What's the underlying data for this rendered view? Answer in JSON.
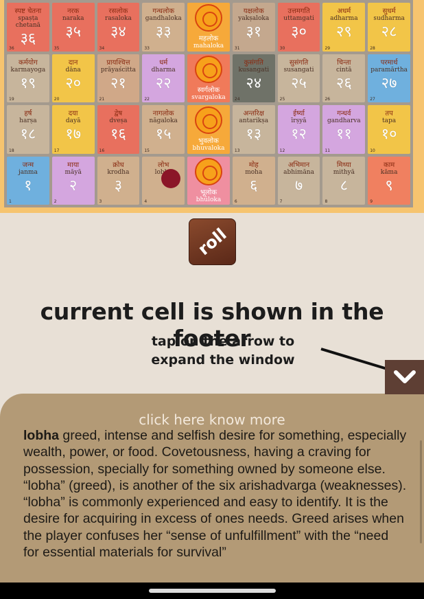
{
  "board": {
    "rows": [
      [
        {
          "dev": "स्पष्ट चेतना",
          "lat": "spaṣṭa chetanā",
          "num": "३६",
          "idx": "36",
          "color": "#e8705e"
        },
        {
          "dev": "नरक",
          "lat": "naraka",
          "num": "३५",
          "idx": "35",
          "color": "#e8705e"
        },
        {
          "dev": "रसलोक",
          "lat": "rasaloka",
          "num": "३४",
          "idx": "34",
          "color": "#e8705e"
        },
        {
          "dev": "गन्धलोक",
          "lat": "gandhaloka",
          "num": "३३",
          "idx": "33",
          "color": "#d0b08e"
        },
        {
          "dev": "महलोक",
          "lat": "mahaloka",
          "num": "",
          "idx": "",
          "color": "#f6a93a",
          "special": true
        },
        {
          "dev": "यक्षलोक",
          "lat": "yakṣaloka",
          "num": "३१",
          "idx": "31",
          "color": "#c4a88e"
        },
        {
          "dev": "उत्तमगति",
          "lat": "uttamgati",
          "num": "३०",
          "idx": "30",
          "color": "#e8705e"
        },
        {
          "dev": "अधर्म",
          "lat": "adharma",
          "num": "२९",
          "idx": "29",
          "color": "#f2c548"
        },
        {
          "dev": "सुधर्म",
          "lat": "sudharma",
          "num": "२८",
          "idx": "28",
          "color": "#f2c548"
        }
      ],
      [
        {
          "dev": "कर्मयोग",
          "lat": "karmayoga",
          "num": "१९",
          "idx": "19",
          "color": "#c7b59c"
        },
        {
          "dev": "दान",
          "lat": "dāna",
          "num": "२०",
          "idx": "20",
          "color": "#f2c548"
        },
        {
          "dev": "प्रायश्चित्त",
          "lat": "prāyaścitta",
          "num": "२१",
          "idx": "21",
          "color": "#d0a888"
        },
        {
          "dev": "धर्म",
          "lat": "dharma",
          "num": "२२",
          "idx": "22",
          "color": "#d4a6df"
        },
        {
          "dev": "स्वर्गलोक",
          "lat": "svargaloka",
          "num": "",
          "idx": "",
          "color": "#f07a5a",
          "special": true
        },
        {
          "dev": "कुसंगति",
          "lat": "kusangati",
          "num": "२४",
          "idx": "24",
          "color": "#6f7268"
        },
        {
          "dev": "सुसंगति",
          "lat": "susangati",
          "num": "२५",
          "idx": "25",
          "color": "#c7b59c"
        },
        {
          "dev": "चिन्ता",
          "lat": "cintā",
          "num": "२६",
          "idx": "26",
          "color": "#c7b59c"
        },
        {
          "dev": "परमार्थ",
          "lat": "paramārtha",
          "num": "२७",
          "idx": "27",
          "color": "#6fb0de"
        }
      ],
      [
        {
          "dev": "हर्ष",
          "lat": "harṣa",
          "num": "१८",
          "idx": "18",
          "color": "#c7b59c"
        },
        {
          "dev": "दया",
          "lat": "dayā",
          "num": "१७",
          "idx": "17",
          "color": "#f2c548"
        },
        {
          "dev": "द्वेष",
          "lat": "dveṣa",
          "num": "१६",
          "idx": "16",
          "color": "#e8705e"
        },
        {
          "dev": "नागलोक",
          "lat": "nāgaloka",
          "num": "१५",
          "idx": "15",
          "color": "#d0b08e"
        },
        {
          "dev": "भुवलोक",
          "lat": "bhuvaloka",
          "num": "",
          "idx": "",
          "color": "#f6a93a",
          "special": true
        },
        {
          "dev": "अन्तरिक्ष",
          "lat": "antarikṣa",
          "num": "१३",
          "idx": "13",
          "color": "#c7b59c"
        },
        {
          "dev": "ईर्ष्या",
          "lat": "īrṣyā",
          "num": "१२",
          "idx": "12",
          "color": "#d4a6df"
        },
        {
          "dev": "गन्धर्व",
          "lat": "gandharva",
          "num": "११",
          "idx": "11",
          "color": "#d4a6df"
        },
        {
          "dev": "तप",
          "lat": "tapa",
          "num": "१०",
          "idx": "10",
          "color": "#f2c548"
        }
      ],
      [
        {
          "dev": "जन्म",
          "lat": "janma",
          "num": "१",
          "idx": "1",
          "color": "#6fb0de"
        },
        {
          "dev": "माया",
          "lat": "māyā",
          "num": "२",
          "idx": "2",
          "color": "#d4a6df"
        },
        {
          "dev": "क्रोध",
          "lat": "krodha",
          "num": "३",
          "idx": "3",
          "color": "#d0b08e"
        },
        {
          "dev": "लोभ",
          "lat": "lobha",
          "num": "",
          "idx": "4",
          "color": "#d0b08e"
        },
        {
          "dev": "भूलोक",
          "lat": "bhūloka",
          "num": "",
          "idx": "",
          "color": "#ef8fa0",
          "special": true
        },
        {
          "dev": "मोह",
          "lat": "moha",
          "num": "६",
          "idx": "6",
          "color": "#d0b08e"
        },
        {
          "dev": "अभिमान",
          "lat": "abhimāna",
          "num": "७",
          "idx": "7",
          "color": "#c7b59c"
        },
        {
          "dev": "मिथ्या",
          "lat": "mithyā",
          "num": "८",
          "idx": "8",
          "color": "#c7b59c"
        },
        {
          "dev": "काम",
          "lat": "kāma",
          "num": "९",
          "idx": "9",
          "color": "#f08060"
        }
      ]
    ]
  },
  "roll": {
    "label": "roll"
  },
  "tutorial": {
    "heading": "current cell is shown in the footer",
    "hint": "tap on the arrow to expand the window"
  },
  "footer": {
    "more_link": "click here know more",
    "term": "lobha",
    "description": " greed, intense and selfish desire for something, especially wealth, power, or food. Covetousness, having a craving for possession, specially for something owned by someone else. “lobha” (greed), is another of the six arishadvarga (weaknesses). “lobha” is commonly experienced and easy to identify. It is the desire for acquiring in excess of ones needs. Greed arises when the player confuses her “sense of unfulfillment” with the “need for essential materials for survival”"
  }
}
